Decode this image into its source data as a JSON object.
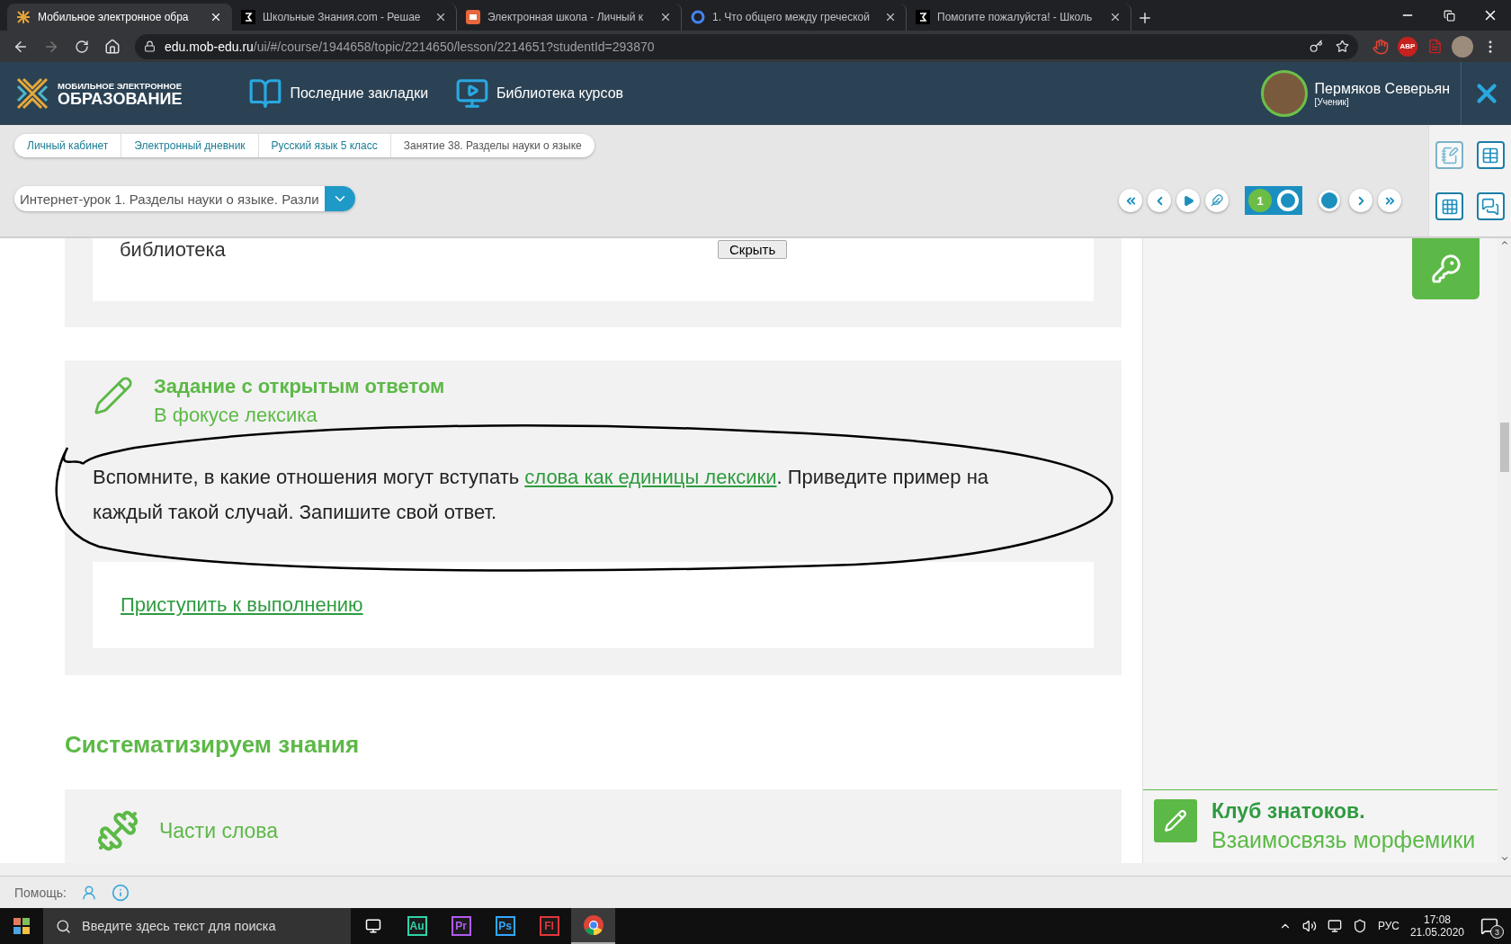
{
  "browser": {
    "tabs": [
      {
        "title": "Мобильное электронное обра",
        "kind": "logo",
        "selected": true
      },
      {
        "title": "Школьные Знания.com - Решае",
        "kind": "square",
        "selected": false
      },
      {
        "title": "Электронная школа - Личный к",
        "kind": "school",
        "selected": false
      },
      {
        "title": "1. Что общего между греческой",
        "kind": "google",
        "selected": false
      },
      {
        "title": "Помогите пожалуйста! - Школь",
        "kind": "square",
        "selected": false
      }
    ],
    "address": {
      "domain": "edu.mob-edu.ru",
      "path": "/ui/#/course/1944658/topic/2214650/lesson/2214651?studentId=293870"
    },
    "extensions": [
      "ABP"
    ]
  },
  "site_header": {
    "logo": {
      "line1": "МОБИЛЬНОЕ ЭЛЕКТРОННОЕ",
      "line2": "ОБРАЗОВАНИЕ"
    },
    "nav": [
      {
        "label": "Последние закладки",
        "kind": "book"
      },
      {
        "label": "Библиотека курсов",
        "kind": "video"
      }
    ],
    "user": {
      "name": "Пермяков Северьян",
      "role": "[Ученик]"
    }
  },
  "breadcrumbs": [
    {
      "label": "Личный кабинет",
      "current": false
    },
    {
      "label": "Электронный дневник",
      "current": false
    },
    {
      "label": "Русский язык 5 класс",
      "current": false
    },
    {
      "label": "Занятие 38. Разделы науки о языке",
      "current": true
    }
  ],
  "lesson_select": {
    "value": "Интернет-урок 1. Разделы науки о языке. Разли"
  },
  "lesson_nav": {
    "page": "1"
  },
  "content": {
    "prev_card": {
      "text": "библиотека",
      "button": "Скрыть"
    },
    "task": {
      "title": "Задание с открытым ответом",
      "subtitle": "В фокусе лексика",
      "text_before": "Вспомните, в какие отношения могут вступать ",
      "link": "слова как единицы лексики",
      "text_after": ". Приведите пример на каждый такой случай. Запишите свой ответ.",
      "action": "Приступить к выполнению"
    },
    "section_heading": "Систематизируем знания",
    "next_item": {
      "title": "Части слова"
    }
  },
  "side": {
    "club": {
      "title": "Клуб знатоков.",
      "subtitle": "Взаимосвязь морфемики"
    }
  },
  "help": {
    "label": "Помощь:"
  },
  "taskbar": {
    "search_placeholder": "Введите здесь текст для поиска",
    "apps": [
      {
        "label": "Au",
        "color": "#2fd3a8"
      },
      {
        "label": "Pr",
        "color": "#b05cf0"
      },
      {
        "label": "Ps",
        "color": "#31a8ff"
      },
      {
        "label": "Fl",
        "color": "#e2363a"
      }
    ],
    "lang": "РУС",
    "time": "17:08",
    "date": "21.05.2020",
    "notifications": "3"
  }
}
